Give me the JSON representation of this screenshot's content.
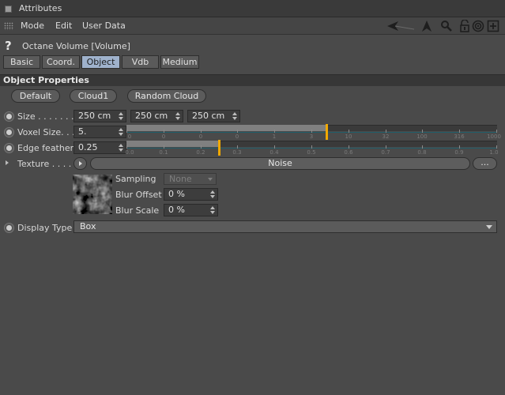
{
  "window": {
    "title": "Attributes"
  },
  "menu": {
    "items": [
      "Mode",
      "Edit",
      "User Data"
    ]
  },
  "toolbar": {
    "icons": [
      "back-arrow-icon",
      "up-arrow-icon",
      "search-icon",
      "lock-icon",
      "target-icon",
      "new-panel-icon"
    ]
  },
  "header": {
    "object_name": "Octane Volume [Volume]"
  },
  "tabs": [
    {
      "label": "Basic",
      "active": false
    },
    {
      "label": "Coord.",
      "active": false
    },
    {
      "label": "Object",
      "active": true
    },
    {
      "label": "Vdb",
      "active": false
    },
    {
      "label": "Medium",
      "active": false
    }
  ],
  "section": {
    "title": "Object Properties"
  },
  "presets": {
    "default": "Default",
    "cloud1": "Cloud1",
    "random_cloud": "Random Cloud"
  },
  "params": {
    "size": {
      "label": "Size . . . . . . . .",
      "x": "250 cm",
      "y": "250 cm",
      "z": "250 cm"
    },
    "voxel_size": {
      "label": "Voxel Size. . . .",
      "value": "5.",
      "slider_fraction": 0.54,
      "scale": [
        "0",
        "0",
        "0",
        "0",
        "1",
        "3",
        "10",
        "32",
        "100",
        "316",
        "1000"
      ]
    },
    "edge_feather": {
      "label": "Edge feather",
      "value": "0.25",
      "slider_fraction": 0.25,
      "scale": [
        "0.0",
        "0.1",
        "0.2",
        "0.3",
        "0.4",
        "0.5",
        "0.6",
        "0.7",
        "0.8",
        "0.9",
        "1.0"
      ]
    },
    "texture": {
      "label": "Texture . . . . . .",
      "name": "Noise",
      "more": "..."
    },
    "sampling": {
      "label": "Sampling",
      "value": "None"
    },
    "blur_offset": {
      "label": "Blur Offset",
      "value": "0 %"
    },
    "blur_scale": {
      "label": "Blur Scale",
      "value": "0 %"
    },
    "display_type": {
      "label": "Display Type",
      "value": "Box"
    }
  }
}
